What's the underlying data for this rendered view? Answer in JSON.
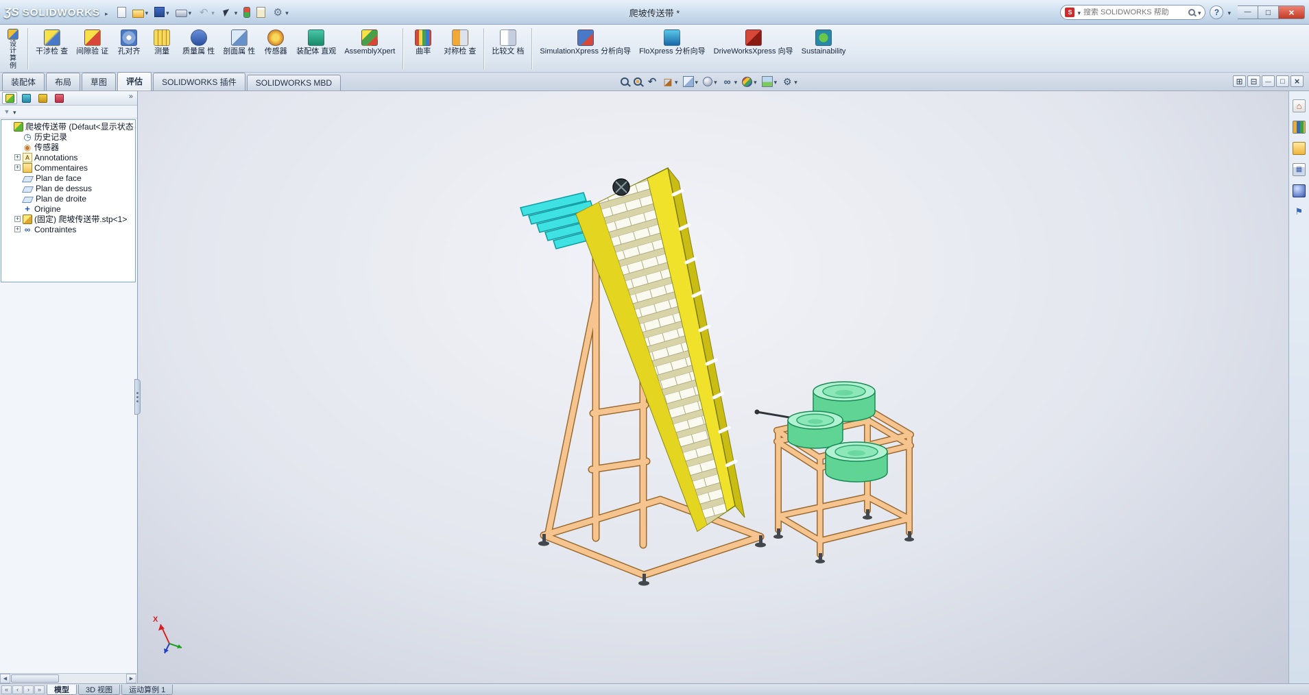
{
  "window": {
    "logo_prefix": "ƷS",
    "logo_text": "SOLIDWORKS",
    "title": "爬坡传送带 *",
    "search_placeholder": "搜索 SOLIDWORKS 帮助"
  },
  "quick_access": {
    "items": [
      {
        "name": "new-button",
        "icon": "new-doc-icon"
      },
      {
        "name": "open-button",
        "icon": "open-folder-icon",
        "caret": true
      },
      {
        "name": "save-button",
        "icon": "save-icon",
        "caret": true
      },
      {
        "name": "print-button",
        "icon": "print-icon",
        "caret": true
      },
      {
        "name": "undo-button",
        "icon": "undo-icon",
        "caret": true,
        "grayed": true
      },
      {
        "name": "select-button",
        "icon": "select-arrow-icon",
        "caret": true
      },
      {
        "name": "rebuild-button",
        "icon": "rebuild-icon"
      },
      {
        "name": "file-properties-button",
        "icon": "file-properties-icon"
      },
      {
        "name": "options-button",
        "icon": "options-icon",
        "caret": true
      }
    ]
  },
  "window_buttons": {
    "items": [
      {
        "name": "minimize-button",
        "icon": "minimize-icon"
      },
      {
        "name": "maximize-button",
        "icon": "maximize-icon"
      },
      {
        "name": "close-button",
        "icon": "close-icon",
        "close": true
      }
    ]
  },
  "ribbon": {
    "buttons": [
      {
        "name": "design-study-button",
        "icon": "design-study-icon",
        "line1": "设计算例",
        "line2": "",
        "tall": true,
        "caret": true
      },
      {
        "sep": true
      },
      {
        "name": "interference-check-button",
        "icon": "interference-check-icon",
        "line1": "干涉检",
        "line2": "查"
      },
      {
        "name": "clearance-verification-button",
        "icon": "clearance-verification-icon",
        "line1": "间隙验",
        "line2": "证"
      },
      {
        "name": "hole-alignment-button",
        "icon": "hole-alignment-icon",
        "line1": "孔对齐",
        "line2": ""
      },
      {
        "name": "measure-button",
        "icon": "measure-icon",
        "line1": "测量",
        "line2": ""
      },
      {
        "name": "mass-properties-button",
        "icon": "mass-properties-icon",
        "line1": "质量属",
        "line2": "性"
      },
      {
        "name": "section-properties-button",
        "icon": "section-properties-icon",
        "line1": "剖面属",
        "line2": "性"
      },
      {
        "name": "sensor-button",
        "icon": "sensor-icon",
        "line1": "传感器",
        "line2": ""
      },
      {
        "name": "assembly-visualization-button",
        "icon": "assembly-visualization-icon",
        "line1": "装配体",
        "line2": "直观"
      },
      {
        "name": "assemblyxpert-button",
        "icon": "assemblyxpert-icon",
        "line1": "AssemblyXpert",
        "line2": ""
      },
      {
        "sep": true
      },
      {
        "name": "curvature-button",
        "icon": "curvature-icon",
        "line1": "曲率",
        "line2": ""
      },
      {
        "name": "symmetry-check-button",
        "icon": "symmetry-check-icon",
        "line1": "对称检",
        "line2": "查"
      },
      {
        "sep": true
      },
      {
        "name": "compare-documents-button",
        "icon": "compare-documents-icon",
        "line1": "比较文",
        "line2": "档"
      },
      {
        "sep": true
      },
      {
        "name": "simulationxpress-button",
        "icon": "simulationxpress-icon",
        "line1": "SimulationXpress",
        "line2": "分析向导"
      },
      {
        "name": "floxpress-button",
        "icon": "floxpress-icon",
        "line1": "FloXpress",
        "line2": "分析向导"
      },
      {
        "name": "driveworksxpress-button",
        "icon": "driveworksxpress-icon",
        "line1": "DriveWorksXpress",
        "line2": "向导"
      },
      {
        "name": "sustainability-button",
        "icon": "sustainability-icon",
        "line1": "Sustainability",
        "line2": ""
      }
    ]
  },
  "tabs": {
    "items": [
      {
        "name": "tab-assembly",
        "label": "装配体"
      },
      {
        "name": "tab-layout",
        "label": "布局"
      },
      {
        "name": "tab-sketch",
        "label": "草图"
      },
      {
        "name": "tab-evaluate",
        "label": "评估",
        "active": true
      },
      {
        "name": "tab-solidworks-addins",
        "label": "SOLIDWORKS 插件"
      },
      {
        "name": "tab-solidworks-mbd",
        "label": "SOLIDWORKS MBD"
      }
    ]
  },
  "headsup": {
    "items": [
      {
        "name": "zoom-fit-button",
        "icon": "zoom-fit-icon"
      },
      {
        "name": "zoom-area-button",
        "icon": "zoom-area-icon"
      },
      {
        "name": "previous-view-button",
        "icon": "previous-view-icon"
      },
      {
        "name": "section-view-button",
        "icon": "section-view-icon",
        "caret": true
      },
      {
        "name": "view-orientation-button",
        "icon": "view-cube-icon",
        "caret": true
      },
      {
        "name": "display-style-button",
        "icon": "display-style-icon",
        "caret": true
      },
      {
        "name": "hide-show-items-button",
        "icon": "hide-show-icon",
        "caret": true
      },
      {
        "name": "edit-appearance-button",
        "icon": "appearance-ball-icon",
        "caret": true
      },
      {
        "name": "apply-scene-button",
        "icon": "scene-icon",
        "caret": true
      },
      {
        "name": "view-settings-button",
        "icon": "view-settings-icon",
        "caret": true
      }
    ]
  },
  "doc_controls": {
    "items": [
      {
        "name": "viewport-layout-button",
        "icon": "pane-grid-icon"
      },
      {
        "name": "viewport-split-button",
        "icon": "pane-split-icon"
      },
      {
        "name": "doc-minimize-button",
        "icon": "doc-minimize-icon"
      },
      {
        "name": "doc-restore-button",
        "icon": "doc-restore-icon"
      },
      {
        "name": "doc-close-button",
        "icon": "doc-close-icon"
      }
    ]
  },
  "feature_tree": {
    "overflow_label": "»",
    "panel_tabs": [
      {
        "name": "featuremanager-tab",
        "icon": "featuremanager-icon",
        "active": true
      },
      {
        "name": "propertymanager-tab",
        "icon": "propertymanager-icon"
      },
      {
        "name": "configurationmanager-tab",
        "icon": "configurationmanager-icon"
      },
      {
        "name": "dimxpertmanager-tab",
        "icon": "dimxpert-icon"
      }
    ],
    "items": [
      {
        "name": "tree-item-root",
        "icon": "assembly-icon",
        "label": "爬坡传送带 (Défaut<显示状态",
        "indent": 0
      },
      {
        "name": "tree-item-history",
        "icon": "history-icon",
        "label": "历史记录",
        "indent": 1
      },
      {
        "name": "tree-item-sensors",
        "icon": "sensor-folder-icon",
        "label": "传感器",
        "indent": 1
      },
      {
        "name": "tree-item-annotations",
        "icon": "annotations-icon",
        "label": "Annotations",
        "indent": 1,
        "expand": "+"
      },
      {
        "name": "tree-item-comments",
        "icon": "comments-icon",
        "label": "Commentaires",
        "indent": 1,
        "expand": "+"
      },
      {
        "name": "tree-item-front-plane",
        "icon": "plane-icon",
        "label": "Plan de face",
        "indent": 1
      },
      {
        "name": "tree-item-top-plane",
        "icon": "plane-icon",
        "label": "Plan de dessus",
        "indent": 1
      },
      {
        "name": "tree-item-right-plane",
        "icon": "plane-icon",
        "label": "Plan de droite",
        "indent": 1
      },
      {
        "name": "tree-item-origin",
        "icon": "origin-icon",
        "label": "Origine",
        "indent": 1
      },
      {
        "name": "tree-item-part",
        "icon": "part-icon",
        "label": "(固定) 爬坡传送带.stp<1>",
        "indent": 1,
        "expand": "+"
      },
      {
        "name": "tree-item-mates",
        "icon": "mates-icon",
        "label": "Contraintes",
        "indent": 1,
        "expand": "+"
      }
    ]
  },
  "task_pane": {
    "items": [
      {
        "name": "taskpane-resources-button",
        "icon": "home-icon"
      },
      {
        "name": "taskpane-design-library-button",
        "icon": "library-icon"
      },
      {
        "name": "taskpane-file-explorer-button",
        "icon": "folder-search-icon"
      },
      {
        "name": "taskpane-view-palette-button",
        "icon": "palette-icon"
      },
      {
        "name": "taskpane-appearances-button",
        "icon": "appearance-sphere-icon"
      },
      {
        "name": "taskpane-custom-properties-button",
        "icon": "tag-icon"
      }
    ]
  },
  "bottom_tabs": {
    "items": [
      {
        "name": "model-tab",
        "label": "模型",
        "active": true
      },
      {
        "name": "3d-views-tab",
        "label": "3D 视图"
      },
      {
        "name": "motion-study-tab",
        "label": "运动算例 1"
      }
    ]
  },
  "viewport": {
    "triad_x_label": "X"
  },
  "model_colors": {
    "conveyor_rail": "#f0e22a",
    "conveyor_side": "#c9bd14",
    "frame": "#f6c48e",
    "chute": "#3fe2e2",
    "bowl_body": "#5fd494",
    "bowl_top": "#b2f2d2",
    "foot": "#43484f"
  }
}
